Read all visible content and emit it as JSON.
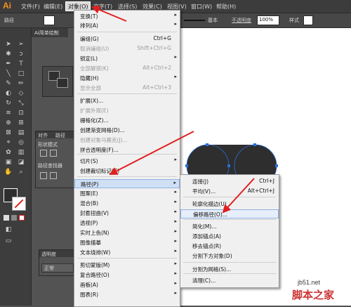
{
  "app": {
    "logo": "Ai",
    "tab_label": "Ai简单绘制"
  },
  "menubar": {
    "items": [
      "文件(F)",
      "编辑(E)",
      "对象(O)",
      "文字(T)",
      "选择(S)",
      "效果(C)",
      "视图(V)",
      "窗口(W)",
      "帮助(H)"
    ]
  },
  "control_bar": {
    "path_label": "路径",
    "stroke_style": "基本",
    "opacity_label": "不透明度",
    "opacity_value": "100%",
    "style_label": "样式"
  },
  "panels": {
    "align_tab": "对齐",
    "path_tab": "路径",
    "shape_mode_label": "形状模式",
    "pathfinder_label": "路径查找器",
    "transparency_label": "透明度",
    "blend_mode": "正常"
  },
  "object_menu": {
    "items": [
      {
        "label": "变换(T)",
        "shortcut": "",
        "submenu": true,
        "disabled": false
      },
      {
        "label": "排列(A)",
        "shortcut": "",
        "submenu": true,
        "disabled": false
      },
      {
        "label": "编组(G)",
        "shortcut": "Ctrl+G",
        "submenu": false,
        "disabled": false
      },
      {
        "label": "取消编组(U)",
        "shortcut": "Shift+Ctrl+G",
        "submenu": false,
        "disabled": true
      },
      {
        "label": "锁定(L)",
        "shortcut": "",
        "submenu": true,
        "disabled": false
      },
      {
        "label": "全部解锁(K)",
        "shortcut": "Alt+Ctrl+2",
        "submenu": false,
        "disabled": true
      },
      {
        "label": "隐藏(H)",
        "shortcut": "",
        "submenu": true,
        "disabled": false
      },
      {
        "label": "显示全部",
        "shortcut": "Alt+Ctrl+3",
        "submenu": false,
        "disabled": true
      },
      {
        "label": "扩展(X)...",
        "shortcut": "",
        "submenu": false,
        "disabled": false
      },
      {
        "label": "扩展外观(E)",
        "shortcut": "",
        "submenu": false,
        "disabled": true
      },
      {
        "label": "栅格化(Z)...",
        "shortcut": "",
        "submenu": false,
        "disabled": false
      },
      {
        "label": "创建渐变网格(D)...",
        "shortcut": "",
        "submenu": false,
        "disabled": false
      },
      {
        "label": "创建对象马赛克(J)...",
        "shortcut": "",
        "submenu": false,
        "disabled": true
      },
      {
        "label": "拼合透明度(F)...",
        "shortcut": "",
        "submenu": false,
        "disabled": false
      },
      {
        "label": "切片(S)",
        "shortcut": "",
        "submenu": true,
        "disabled": false
      },
      {
        "label": "创建裁切标记(C)",
        "shortcut": "",
        "submenu": false,
        "disabled": false
      },
      {
        "label": "路径(P)",
        "shortcut": "",
        "submenu": true,
        "disabled": false
      },
      {
        "label": "图案(E)",
        "shortcut": "",
        "submenu": true,
        "disabled": false
      },
      {
        "label": "混合(B)",
        "shortcut": "",
        "submenu": true,
        "disabled": false
      },
      {
        "label": "封套扭曲(V)",
        "shortcut": "",
        "submenu": true,
        "disabled": false
      },
      {
        "label": "透视(P)",
        "shortcut": "",
        "submenu": true,
        "disabled": false
      },
      {
        "label": "实时上色(N)",
        "shortcut": "",
        "submenu": true,
        "disabled": false
      },
      {
        "label": "图像描摹",
        "shortcut": "",
        "submenu": true,
        "disabled": false
      },
      {
        "label": "文本绕排(W)",
        "shortcut": "",
        "submenu": true,
        "disabled": false
      },
      {
        "label": "剪切蒙版(M)",
        "shortcut": "",
        "submenu": true,
        "disabled": false
      },
      {
        "label": "复合路径(O)",
        "shortcut": "",
        "submenu": true,
        "disabled": false
      },
      {
        "label": "画板(A)",
        "shortcut": "",
        "submenu": true,
        "disabled": false
      },
      {
        "label": "图表(R)",
        "shortcut": "",
        "submenu": true,
        "disabled": false
      }
    ]
  },
  "path_submenu": {
    "items": [
      {
        "label": "连接(J)",
        "shortcut": "Ctrl+J"
      },
      {
        "label": "平均(V)...",
        "shortcut": "Alt+Ctrl+J"
      },
      {
        "label": "轮廓化描边(U)",
        "shortcut": ""
      },
      {
        "label": "偏移路径(O)...",
        "shortcut": ""
      },
      {
        "label": "简化(M)...",
        "shortcut": ""
      },
      {
        "label": "添加锚点(A)",
        "shortcut": ""
      },
      {
        "label": "移去锚点(R)",
        "shortcut": ""
      },
      {
        "label": "分割下方对象(D)",
        "shortcut": ""
      },
      {
        "label": "分割为网格(S)...",
        "shortcut": ""
      },
      {
        "label": "清理(C)...",
        "shortcut": ""
      }
    ]
  },
  "watermark": {
    "site": "jb51.net",
    "name": "脚本之家"
  },
  "colors": {
    "accent_arrow": "#e02020",
    "shape_fill": "#2e2e2e",
    "anchor_blue": "#2a6fd6"
  }
}
